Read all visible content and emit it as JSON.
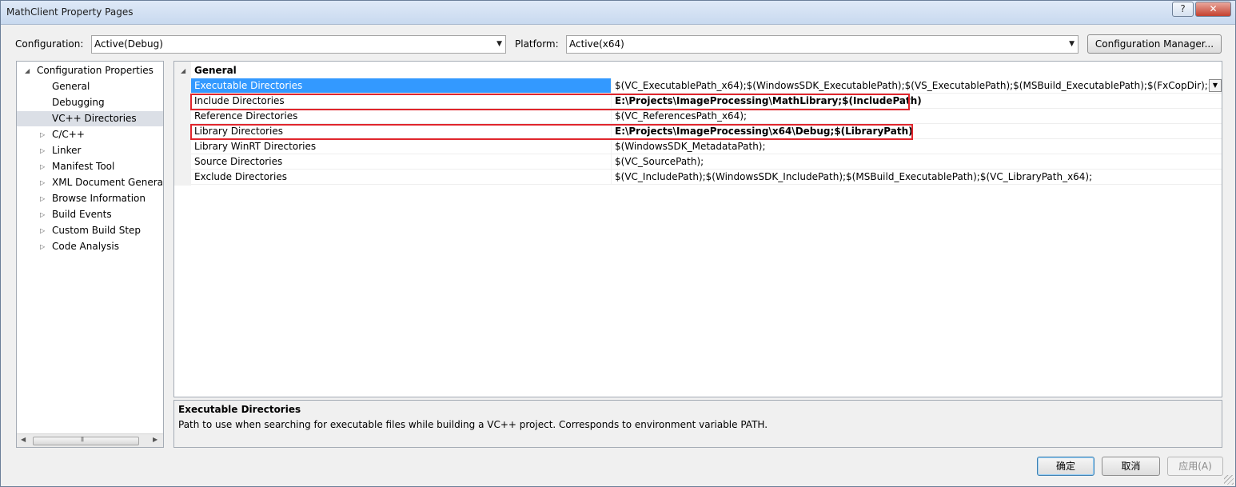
{
  "window": {
    "title": "MathClient Property Pages",
    "help_label": "?",
    "close_label": "✕"
  },
  "toolbar": {
    "configuration_label": "Configuration:",
    "configuration_value": "Active(Debug)",
    "platform_label": "Platform:",
    "platform_value": "Active(x64)",
    "config_manager_label": "Configuration Manager..."
  },
  "tree": {
    "root": "Configuration Properties",
    "items": [
      {
        "label": "General",
        "expandable": false
      },
      {
        "label": "Debugging",
        "expandable": false
      },
      {
        "label": "VC++ Directories",
        "expandable": false,
        "selected": true
      },
      {
        "label": "C/C++",
        "expandable": true
      },
      {
        "label": "Linker",
        "expandable": true
      },
      {
        "label": "Manifest Tool",
        "expandable": true
      },
      {
        "label": "XML Document Generat",
        "expandable": true
      },
      {
        "label": "Browse Information",
        "expandable": true
      },
      {
        "label": "Build Events",
        "expandable": true
      },
      {
        "label": "Custom Build Step",
        "expandable": true
      },
      {
        "label": "Code Analysis",
        "expandable": true
      }
    ]
  },
  "grid": {
    "category": "General",
    "rows": [
      {
        "name": "Executable Directories",
        "value": "$(VC_ExecutablePath_x64);$(WindowsSDK_ExecutablePath);$(VS_ExecutablePath);$(MSBuild_ExecutablePath);$(FxCopDir);$(PATH);",
        "selected": true,
        "bold": false
      },
      {
        "name": "Include Directories",
        "value": "E:\\Projects\\ImageProcessing\\MathLibrary;$(IncludePath)",
        "selected": false,
        "bold": true
      },
      {
        "name": "Reference Directories",
        "value": "$(VC_ReferencesPath_x64);",
        "selected": false,
        "bold": false
      },
      {
        "name": "Library Directories",
        "value": "E:\\Projects\\ImageProcessing\\x64\\Debug;$(LibraryPath)",
        "selected": false,
        "bold": true
      },
      {
        "name": "Library WinRT Directories",
        "value": "$(WindowsSDK_MetadataPath);",
        "selected": false,
        "bold": false
      },
      {
        "name": "Source Directories",
        "value": "$(VC_SourcePath);",
        "selected": false,
        "bold": false
      },
      {
        "name": "Exclude Directories",
        "value": "$(VC_IncludePath);$(WindowsSDK_IncludePath);$(MSBuild_ExecutablePath);$(VC_LibraryPath_x64);",
        "selected": false,
        "bold": false
      }
    ]
  },
  "description": {
    "title": "Executable Directories",
    "text": "Path to use when searching for executable files while building a VC++ project.  Corresponds to environment variable PATH."
  },
  "buttons": {
    "ok": "确定",
    "cancel": "取消",
    "apply": "应用(A)"
  },
  "colors": {
    "selection": "#3399ff",
    "highlight_box": "#e0262d"
  },
  "icons": {
    "expanded": "expanded-triangle-icon",
    "collapsed": "collapsed-triangle-icon",
    "dropdown": "chevron-down-icon"
  }
}
